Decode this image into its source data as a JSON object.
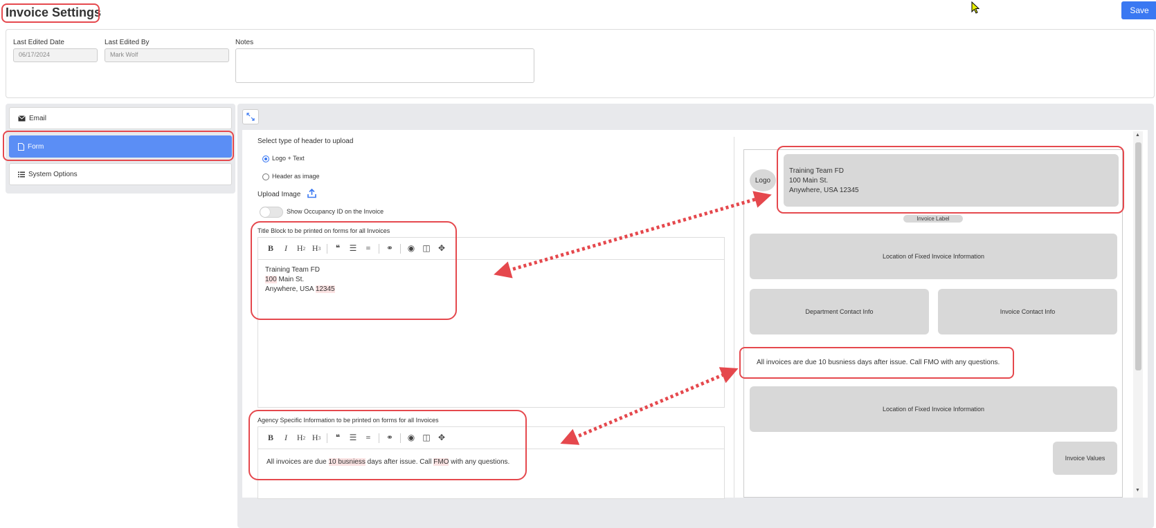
{
  "header": {
    "title": "Invoice Settings",
    "save_label": "Save"
  },
  "meta": {
    "last_edited_date_label": "Last Edited Date",
    "last_edited_date_value": "06/17/2024",
    "last_edited_by_label": "Last Edited By",
    "last_edited_by_value": "Mark Wolf",
    "notes_label": "Notes",
    "notes_value": ""
  },
  "sidebar": {
    "items": [
      {
        "label": "Email",
        "icon": "envelope-icon"
      },
      {
        "label": "Form",
        "icon": "document-icon",
        "active": true
      },
      {
        "label": "System Options",
        "icon": "list-icon"
      }
    ]
  },
  "form": {
    "header_type_label": "Select type of header to upload",
    "radio_options": [
      "Logo + Text",
      "Header as image"
    ],
    "selected_option": "Logo + Text",
    "upload_label": "Upload Image",
    "toggle_label": "Show Occupancy ID on the Invoice",
    "title_block_label": "Title Block to be printed on forms for all Invoices",
    "title_block_lines": [
      "Training Team FD",
      "100 Main St.",
      "Anywhere, USA 12345"
    ],
    "agency_label": "Agency Specific Information to be printed on forms for all Invoices",
    "agency_text": "All invoices are due 10 busniess days after issue. Call FMO with any questions."
  },
  "preview": {
    "logo_label": "Logo",
    "title_lines": [
      "Training Team FD",
      "100 Main St.",
      "Anywhere, USA 12345"
    ],
    "invoice_label": "Invoice Label",
    "fixed_info_label": "Location of Fixed Invoice Information",
    "department_contact": "Department Contact Info",
    "invoice_contact": "Invoice Contact Info",
    "agency_text": "All invoices are due 10 busniess days after issue. Call FMO with any questions.",
    "fixed_info_label_2": "Location of Fixed Invoice Information",
    "invoice_values": "Invoice Values"
  },
  "colors": {
    "accent": "#3a78f2",
    "active_nav": "#5b8ef5",
    "annotation": "#e5484d"
  }
}
